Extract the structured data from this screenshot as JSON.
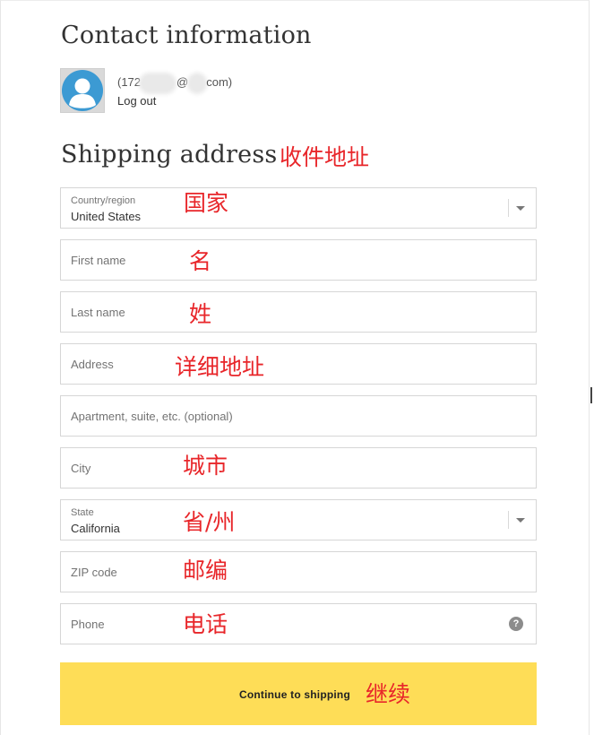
{
  "contact": {
    "title": "Contact information",
    "email_prefix": "(172",
    "email_at": "@",
    "email_suffix": "com)",
    "logout": "Log out"
  },
  "shipping": {
    "title": "Shipping address",
    "title_annotation": "收件地址"
  },
  "fields": {
    "country": {
      "label": "Country/region",
      "value": "United States",
      "annotation": "国家"
    },
    "first_name": {
      "placeholder": "First name",
      "annotation": "名"
    },
    "last_name": {
      "placeholder": "Last name",
      "annotation": "姓"
    },
    "address": {
      "placeholder": "Address",
      "annotation": "详细地址"
    },
    "apartment": {
      "placeholder": "Apartment, suite, etc. (optional)"
    },
    "city": {
      "placeholder": "City",
      "annotation": "城市"
    },
    "state": {
      "label": "State",
      "value": "California",
      "annotation": "省/州"
    },
    "zip": {
      "placeholder": "ZIP code",
      "annotation": "邮编"
    },
    "phone": {
      "placeholder": "Phone",
      "annotation": "电话",
      "help_glyph": "?"
    }
  },
  "continue_button": {
    "label": "Continue to shipping",
    "annotation": "继续"
  },
  "colors": {
    "button": "#fedd57",
    "annotation": "#e8262a",
    "avatar": "#3c9ad3"
  }
}
